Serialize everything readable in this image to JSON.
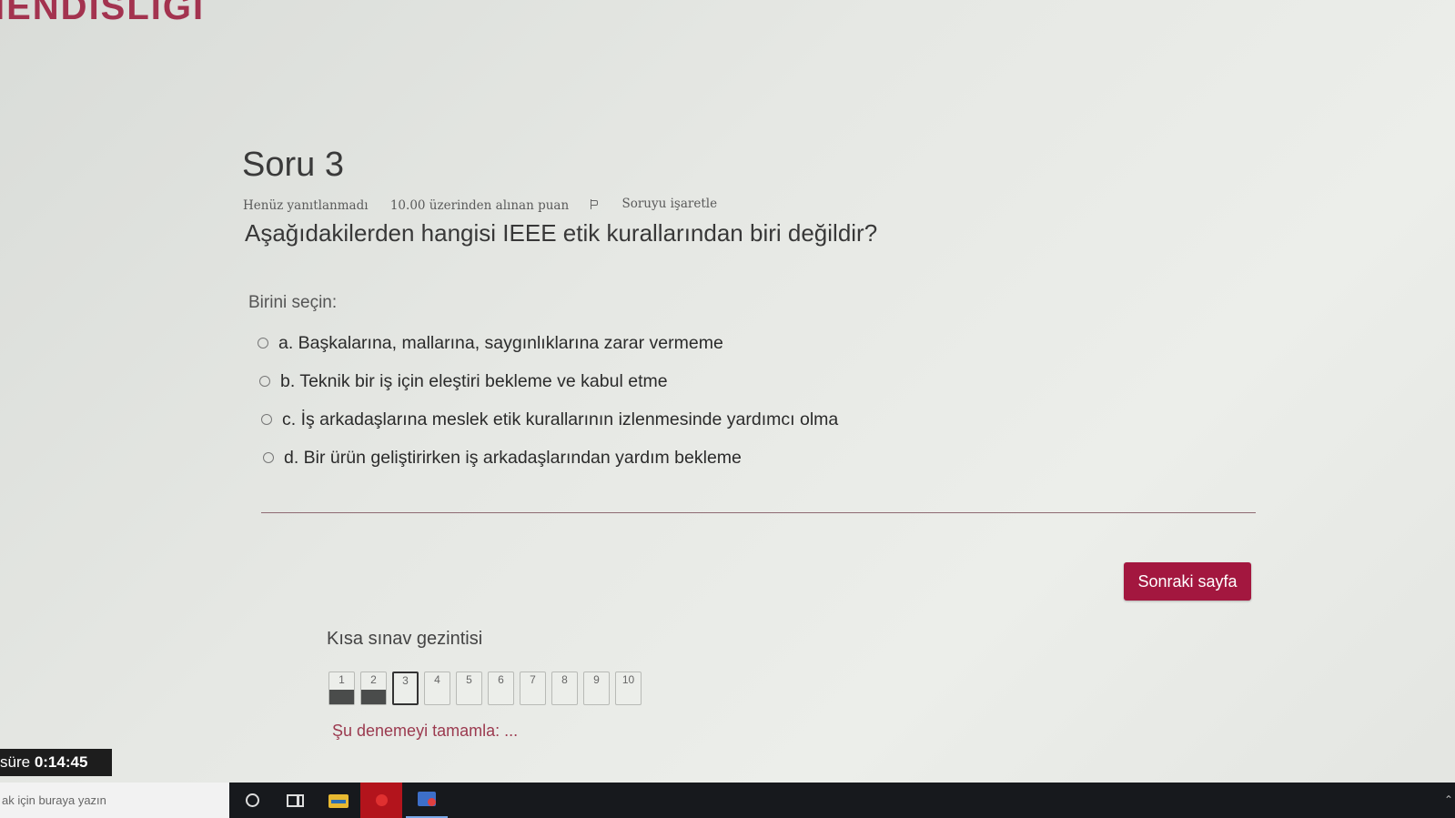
{
  "site": {
    "title": "IENDISLIGI"
  },
  "question": {
    "number_label": "Soru 3",
    "status": "Henüz yanıtlanmadı",
    "points": "10.00 üzerinden alınan puan",
    "flag_label": "Soruyu işaretle",
    "text": "Aşağıdakilerden hangisi IEEE etik kurallarından biri değildir?",
    "prompt": "Birini seçin:",
    "answers": [
      {
        "label": "a. Başkalarına, mallarına, saygınlıklarına zarar vermeme",
        "selected": false
      },
      {
        "label": "b. Teknik bir iş için eleştiri bekleme ve kabul etme",
        "selected": false
      },
      {
        "label": "c. İş arkadaşlarına meslek etik kurallarının izlenmesinde yardımcı olma",
        "selected": false
      },
      {
        "label": "d. Bir ürün geliştirirken iş arkadaşlarından yardım bekleme",
        "selected": false
      }
    ]
  },
  "next_button": {
    "label": "Sonraki sayfa",
    "color": "#a3173f"
  },
  "quiz_nav": {
    "title": "Kısa sınav gezintisi",
    "buttons": [
      {
        "label": "1",
        "state": "answered"
      },
      {
        "label": "2",
        "state": "answered"
      },
      {
        "label": "3",
        "state": "current"
      },
      {
        "label": "4",
        "state": "unanswered"
      },
      {
        "label": "5",
        "state": "unanswered"
      },
      {
        "label": "6",
        "state": "unanswered"
      },
      {
        "label": "7",
        "state": "unanswered"
      },
      {
        "label": "8",
        "state": "unanswered"
      },
      {
        "label": "9",
        "state": "unanswered"
      },
      {
        "label": "10",
        "state": "unanswered"
      }
    ],
    "finish_link": "Şu denemeyi tamamla: ..."
  },
  "timer": {
    "label": "süre",
    "value": "0:14:45"
  },
  "taskbar": {
    "search_text": "ak için buraya yazın",
    "icons": [
      "cortana-icon",
      "task-view-icon",
      "file-explorer-icon",
      "red-app-icon",
      "blue-app-icon"
    ]
  }
}
